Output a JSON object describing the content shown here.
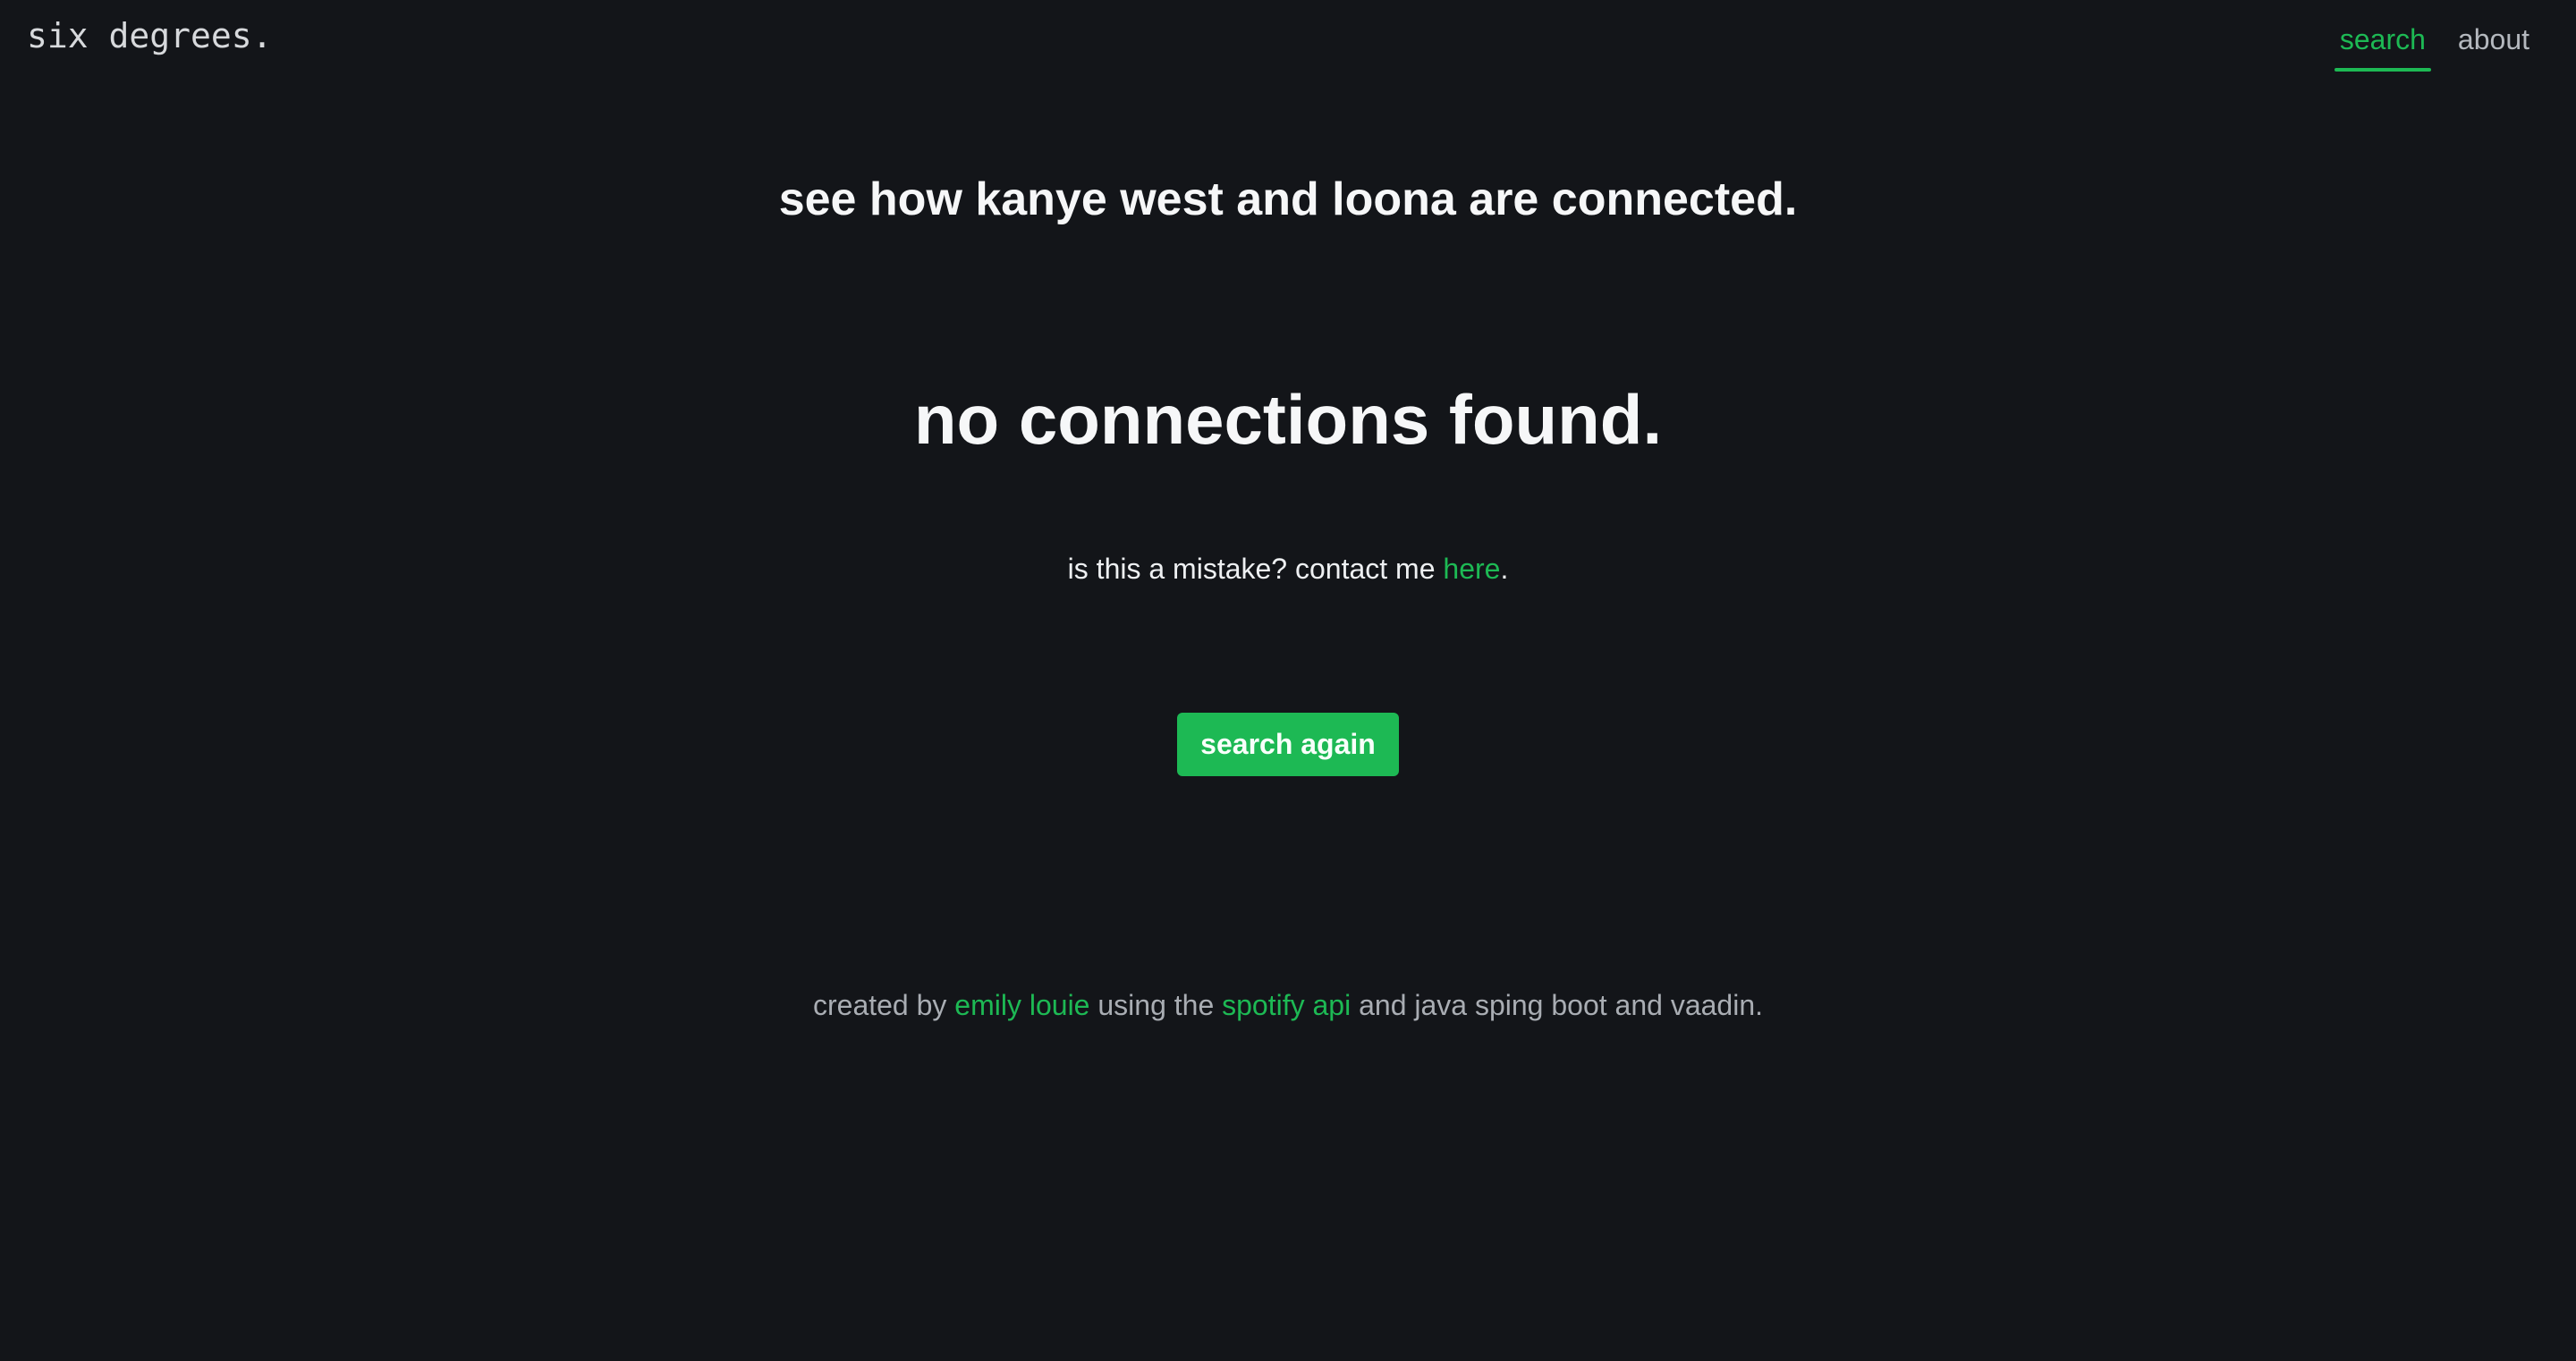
{
  "app": {
    "logo": "six degrees."
  },
  "nav": {
    "tabs": [
      {
        "label": "search",
        "active": true
      },
      {
        "label": "about",
        "active": false
      }
    ]
  },
  "main": {
    "subtitle": "see how kanye west and loona are connected.",
    "headline": "no connections found.",
    "mistake_prefix": "is this a mistake? contact me ",
    "mistake_link": "here",
    "mistake_suffix": ".",
    "button_label": "search again"
  },
  "footer": {
    "part1": "created by ",
    "author_link": "emily louie",
    "part2": " using the ",
    "api_link": "spotify api",
    "part3": " and java sping boot and vaadin."
  },
  "colors": {
    "background": "#131519",
    "accent": "#1db954",
    "text": "#f2f3f4",
    "muted_text": "#a9adb3"
  }
}
